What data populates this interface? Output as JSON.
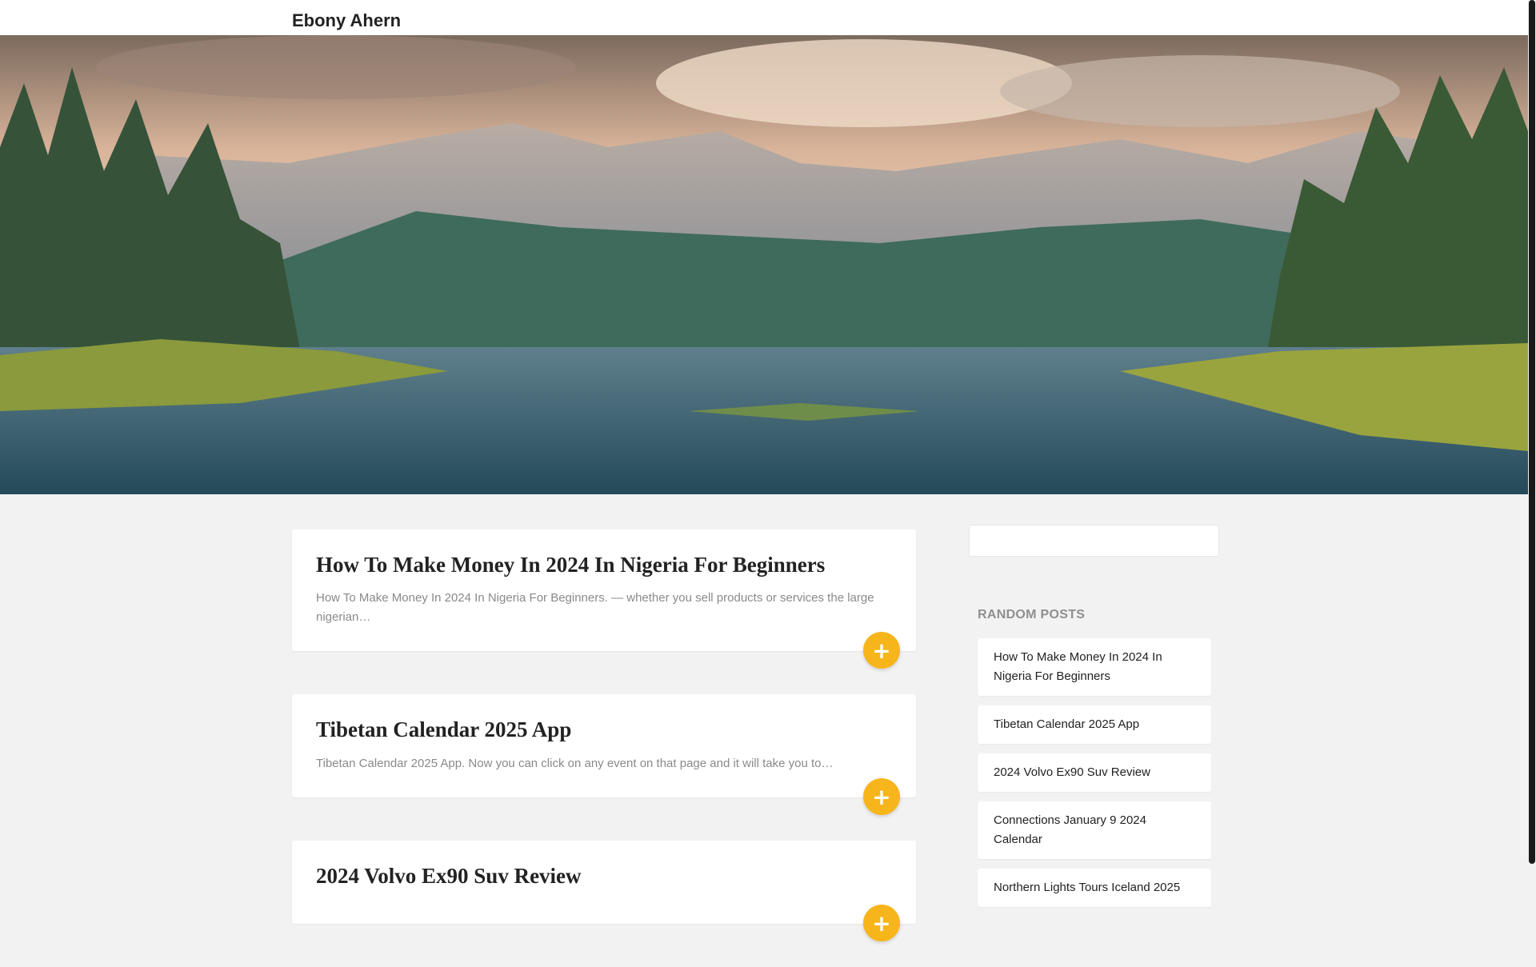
{
  "site": {
    "title": "Ebony Ahern"
  },
  "posts": [
    {
      "title": "How To Make Money In 2024 In Nigeria For Beginners",
      "excerpt": "How To Make Money In 2024 In Nigeria For Beginners. — whether you sell products or services the large nigerian…",
      "more_label": "+"
    },
    {
      "title": "Tibetan Calendar 2025 App",
      "excerpt": "Tibetan Calendar 2025 App. Now you can click on any event on that page and it will take you to…",
      "more_label": "+"
    },
    {
      "title": "2024 Volvo Ex90 Suv Review",
      "excerpt": "",
      "more_label": "+"
    }
  ],
  "sidebar": {
    "random_title": "RANDOM POSTS",
    "random_posts": [
      "How To Make Money In 2024 In Nigeria For Beginners",
      "Tibetan Calendar 2025 App",
      "2024 Volvo Ex90 Suv Review",
      "Connections January 9 2024 Calendar",
      "Northern Lights Tours Iceland 2025"
    ]
  },
  "colors": {
    "accent": "#f7b51c",
    "page_bg": "#f2f2f2"
  },
  "icons": {
    "more": "plus-icon"
  }
}
